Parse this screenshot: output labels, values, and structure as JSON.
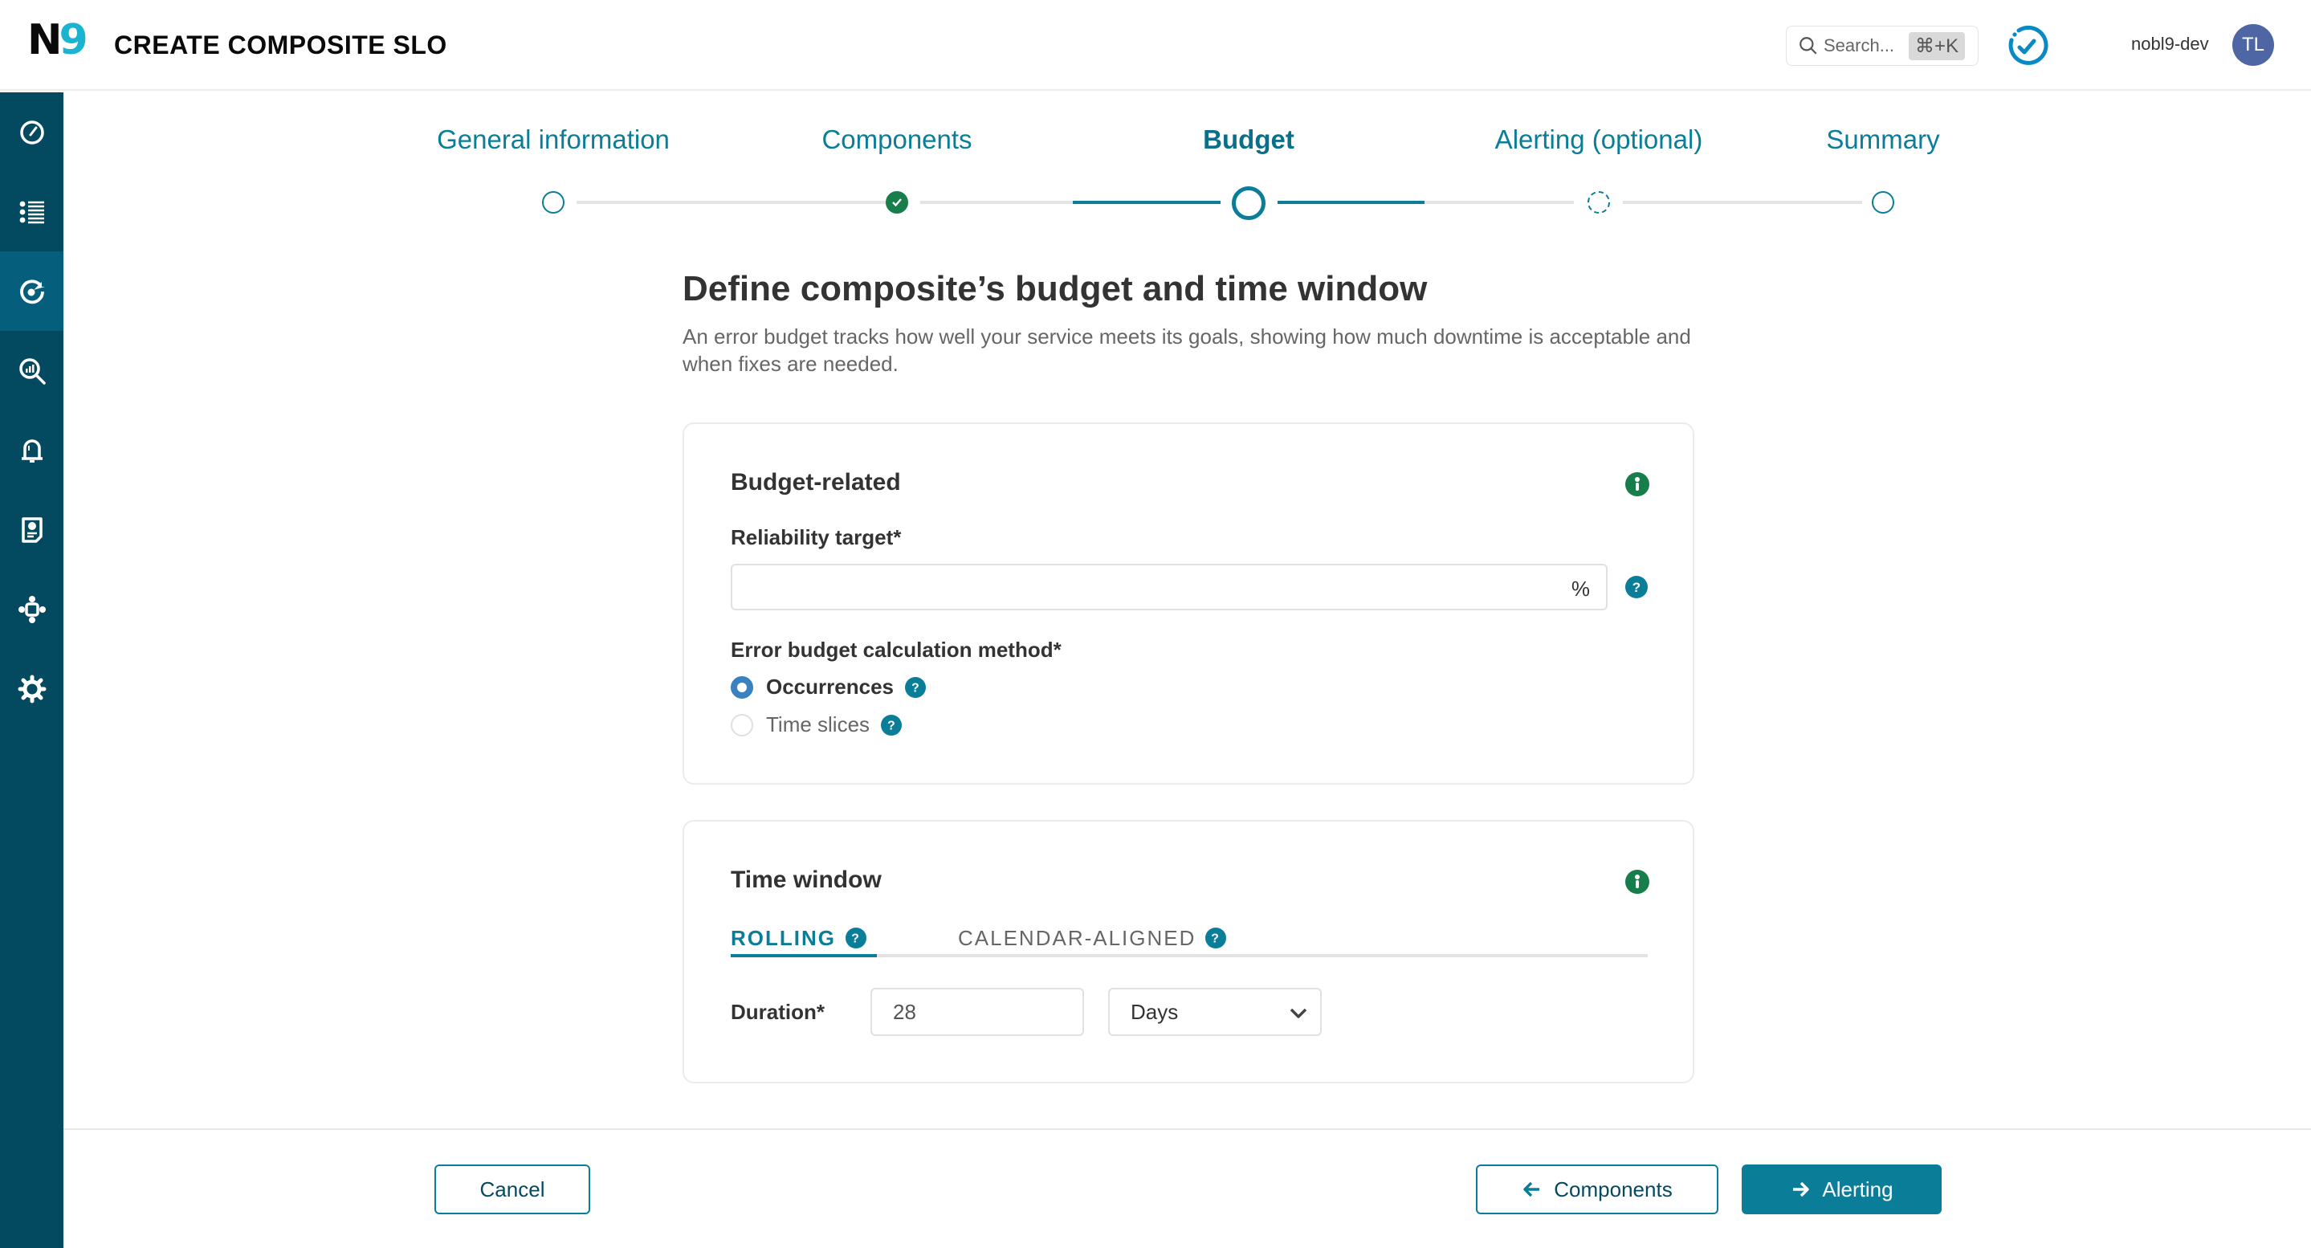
{
  "header": {
    "logo_n": "N",
    "logo_9": "9",
    "title": "CREATE COMPOSITE SLO",
    "search_placeholder": "Search...",
    "search_shortcut": "⌘+K",
    "org_name": "nobl9-dev",
    "avatar_initials": "TL"
  },
  "sidebar": {
    "items": [
      {
        "icon": "dashboard-gauge-icon",
        "active": false
      },
      {
        "icon": "list-icon",
        "active": false
      },
      {
        "icon": "slo-target-icon",
        "active": true
      },
      {
        "icon": "analytics-search-icon",
        "active": false
      },
      {
        "icon": "alert-bell-icon",
        "active": false
      },
      {
        "icon": "report-icon",
        "active": false
      },
      {
        "icon": "integrations-icon",
        "active": false
      },
      {
        "icon": "settings-gear-icon",
        "active": false
      }
    ]
  },
  "stepper": {
    "steps": [
      {
        "label": "General information",
        "state": "visited"
      },
      {
        "label": "Components",
        "state": "done"
      },
      {
        "label": "Budget",
        "state": "current"
      },
      {
        "label": "Alerting (optional)",
        "state": "optional"
      },
      {
        "label": "Summary",
        "state": "upcoming"
      }
    ]
  },
  "main": {
    "title": "Define composite’s budget and time window",
    "description": "An error budget tracks how well your service meets its goals, showing how much downtime is acceptable and when fixes are needed."
  },
  "budget_card": {
    "title": "Budget-related",
    "reliability_label": "Reliability target*",
    "reliability_value": "",
    "reliability_suffix": "%",
    "method_label": "Error budget calculation method*",
    "methods": [
      {
        "label": "Occurrences",
        "selected": true
      },
      {
        "label": "Time slices",
        "selected": false
      }
    ]
  },
  "time_window_card": {
    "title": "Time window",
    "tabs": [
      {
        "label": "ROLLING",
        "active": true
      },
      {
        "label": "CALENDAR-ALIGNED",
        "active": false
      }
    ],
    "duration_label": "Duration*",
    "duration_value": "28",
    "duration_unit": "Days"
  },
  "footer": {
    "cancel_label": "Cancel",
    "back_label": "Components",
    "next_label": "Alerting"
  },
  "colors": {
    "primary": "#0a7e99",
    "sidebar_bg": "#034a60",
    "sidebar_active": "#045e7c",
    "success": "#167d4b",
    "radio_selected": "#3a82bf",
    "logo_accent": "#1ab3d1",
    "avatar_bg": "#4e66a3"
  }
}
